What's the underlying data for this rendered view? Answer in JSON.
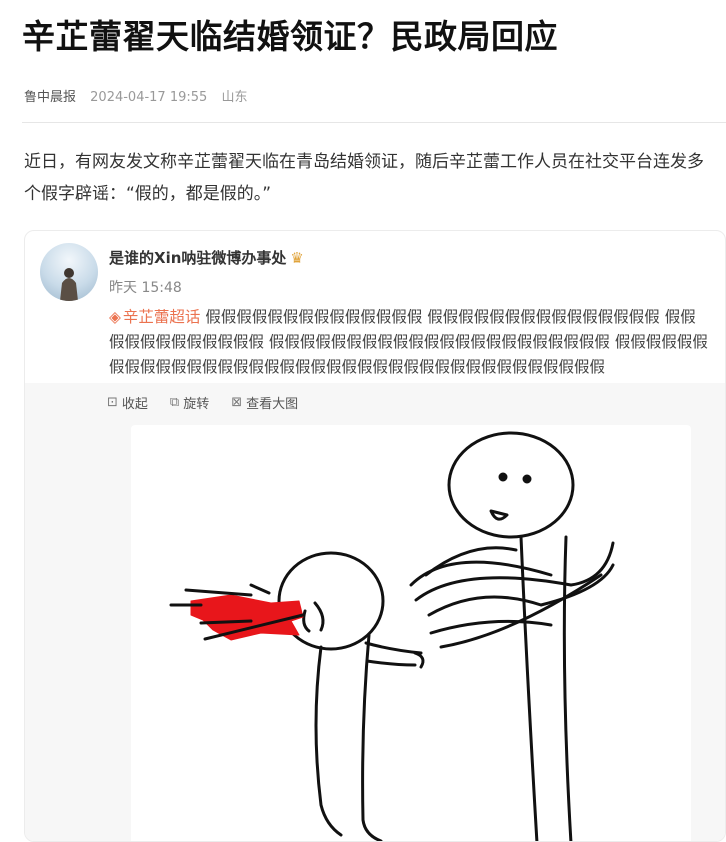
{
  "article": {
    "title": "辛芷蕾翟天临结婚领证？民政局回应",
    "source": "鲁中晨报",
    "date": "2024-04-17 19:55",
    "location": "山东",
    "paragraph": "近日，有网友发文称辛芷蕾翟天临在青岛结婚领证，随后辛芷蕾工作人员在社交平台连发多个假字辟谣：“假的，都是假的。”"
  },
  "weibo": {
    "username": "是谁的Xin呐驻微博办事处",
    "crown_icon": "crown-icon",
    "time": "昨天 15:48",
    "tag": "辛芷蕾超话",
    "content": " 假假假假假假假假假假假假假假 假假假假假假假假假假假假假假假 假假假假假假假假假假假假 假假假假假假假假假假假假假假假假假假假假假假 假假假假假假假假假假假假假假假假假假假假假假假假假假假假假假假假假假假假假假"
  },
  "toolbar": {
    "collect": "收起",
    "rotate": "旋转",
    "view_large": "查看大图"
  },
  "colors": {
    "tag": "#eb7350",
    "splash": "#e8161b"
  }
}
